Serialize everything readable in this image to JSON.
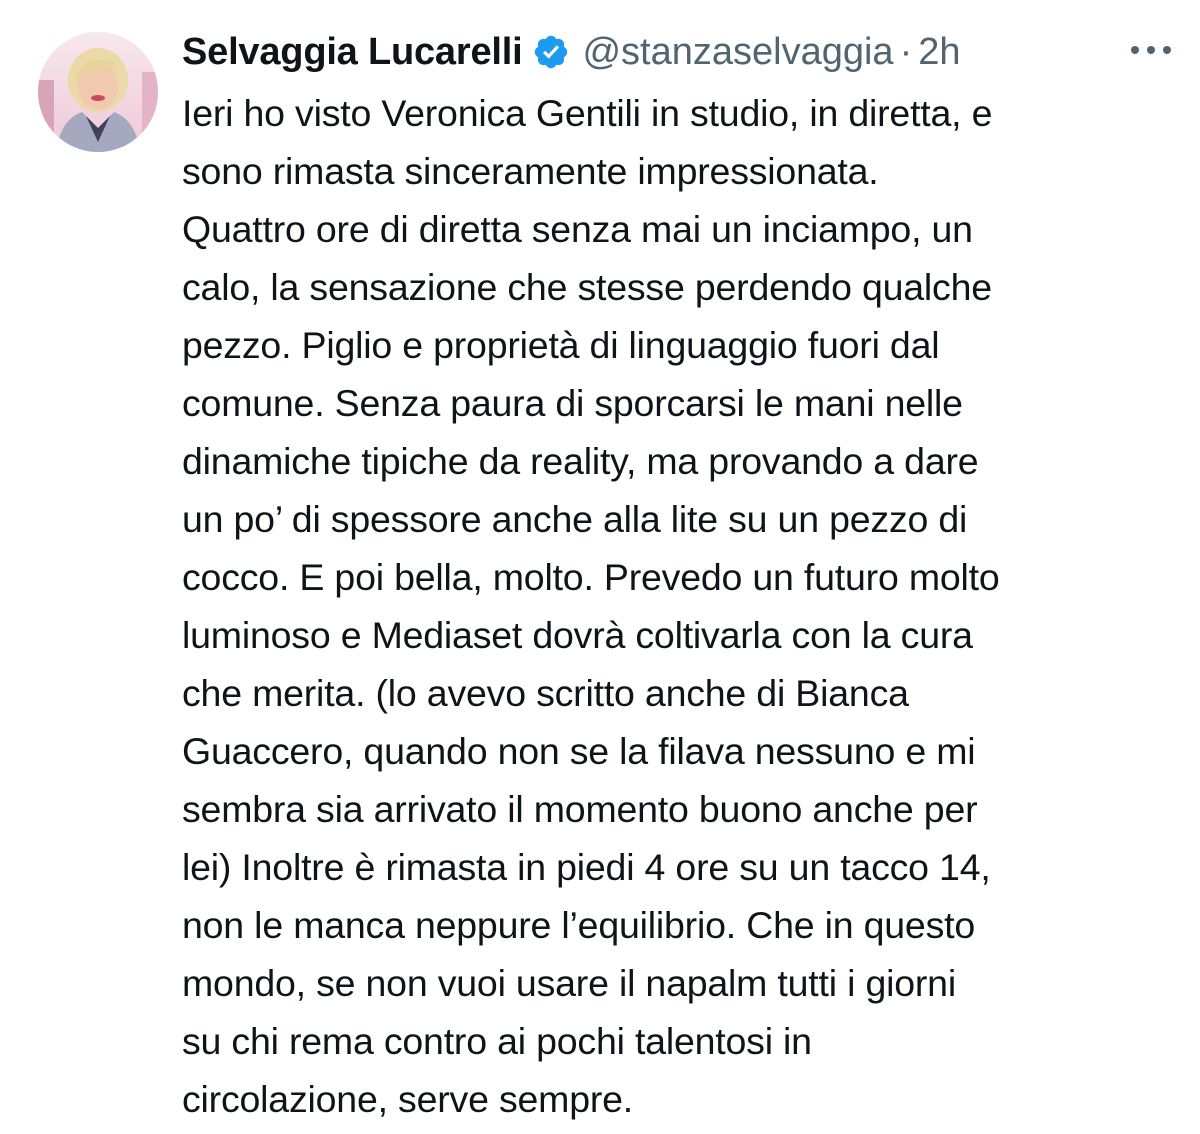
{
  "tweet": {
    "author": {
      "display_name": "Selvaggia Lucarelli",
      "handle": "@stanzaselvaggia",
      "verified": true,
      "avatar_icon": "profile-photo"
    },
    "separator": "·",
    "time": "2h",
    "more_icon": "ellipsis-icon",
    "text": "Ieri ho visto Veronica Gentili in studio, in diretta, e\nsono rimasta sinceramente impressionata.\nQuattro ore di diretta senza mai un inciampo, un\ncalo, la sensazione che stesse perdendo qualche\npezzo. Piglio e proprietà di linguaggio fuori dal\ncomune. Senza paura di sporcarsi le mani nelle\ndinamiche tipiche da reality, ma provando a dare\nun po’ di spessore anche alla lite su un pezzo di\ncocco. E poi bella, molto. Prevedo un futuro molto\nluminoso e Mediaset dovrà coltivarla con la cura\nche merita. (lo avevo scritto anche di Bianca\nGuaccero, quando non se la filava nessuno e mi\nsembra sia arrivato il momento buono anche per\nlei) Inoltre è rimasta in piedi 4 ore su un tacco 14,\nnon le manca neppure l’equilibrio. Che in questo\nmondo, se non vuoi usare il napalm tutti i giorni\nsu chi rema contro ai pochi talentosi in\ncircolazione, serve sempre."
  },
  "colors": {
    "text_primary": "#0f1419",
    "text_secondary": "#536471",
    "verified_blue": "#1d9bf0",
    "background": "#ffffff"
  }
}
